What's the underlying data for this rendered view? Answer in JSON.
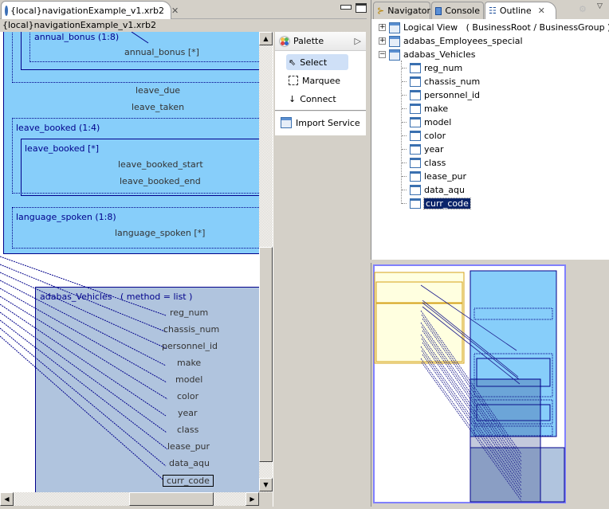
{
  "editor": {
    "tab_label": "{local}navigationExample_v1.xrb2",
    "title_bar": "{local}navigationExample_v1.xrb2",
    "tab_icon": "service-circle-icon",
    "close_icon": "close-icon",
    "minimize_icon": "minimize-icon",
    "maximize_icon": "maximize-icon"
  },
  "diagram": {
    "annual_bonus_group": "annual_bonus (1:8)",
    "annual_bonus_field": "annual_bonus [*]",
    "leave_due": "leave_due",
    "leave_taken": "leave_taken",
    "leave_booked_group": "leave_booked (1:4)",
    "leave_booked_inner": "leave_booked [*]",
    "leave_booked_start": "leave_booked_start",
    "leave_booked_end": "leave_booked_end",
    "language_spoken_group": "language_spoken (1:8)",
    "language_spoken_field": "language_spoken [*]",
    "vehicles_title": "adabas_Vehicles   ( method = list )",
    "vehicles_fields": [
      "reg_num",
      "chassis_num",
      "personnel_id",
      "make",
      "model",
      "color",
      "year",
      "class",
      "lease_pur",
      "data_aqu",
      "curr_code"
    ],
    "selected_field": "curr_code",
    "colors": {
      "employees_fill": "#87cefa",
      "vehicles_fill": "#b0c4de",
      "border": "#00008b"
    }
  },
  "palette": {
    "title": "Palette",
    "items": [
      {
        "label": "Select",
        "icon": "arrow-cursor-icon",
        "selected": true
      },
      {
        "label": "Marquee",
        "icon": "marquee-icon",
        "selected": false
      },
      {
        "label": "Connect",
        "icon": "connect-arrow-icon",
        "selected": false
      }
    ],
    "import_service": "Import Service"
  },
  "views": {
    "tabs": [
      {
        "label": "Navigator",
        "icon": "navigator-icon"
      },
      {
        "label": "Console",
        "icon": "console-icon"
      },
      {
        "label": "Outline",
        "icon": "outline-icon",
        "active": true
      }
    ]
  },
  "outline": {
    "roots": [
      {
        "label": "Logical View   ( BusinessRoot / BusinessGroup )",
        "expanded": false
      },
      {
        "label": "adabas_Employees_special",
        "expanded": false
      },
      {
        "label": "adabas_Vehicles",
        "expanded": true
      }
    ],
    "children": [
      "reg_num",
      "chassis_num",
      "personnel_id",
      "make",
      "model",
      "color",
      "year",
      "class",
      "lease_pur",
      "data_aqu",
      "curr_code"
    ],
    "selected": "curr_code"
  }
}
